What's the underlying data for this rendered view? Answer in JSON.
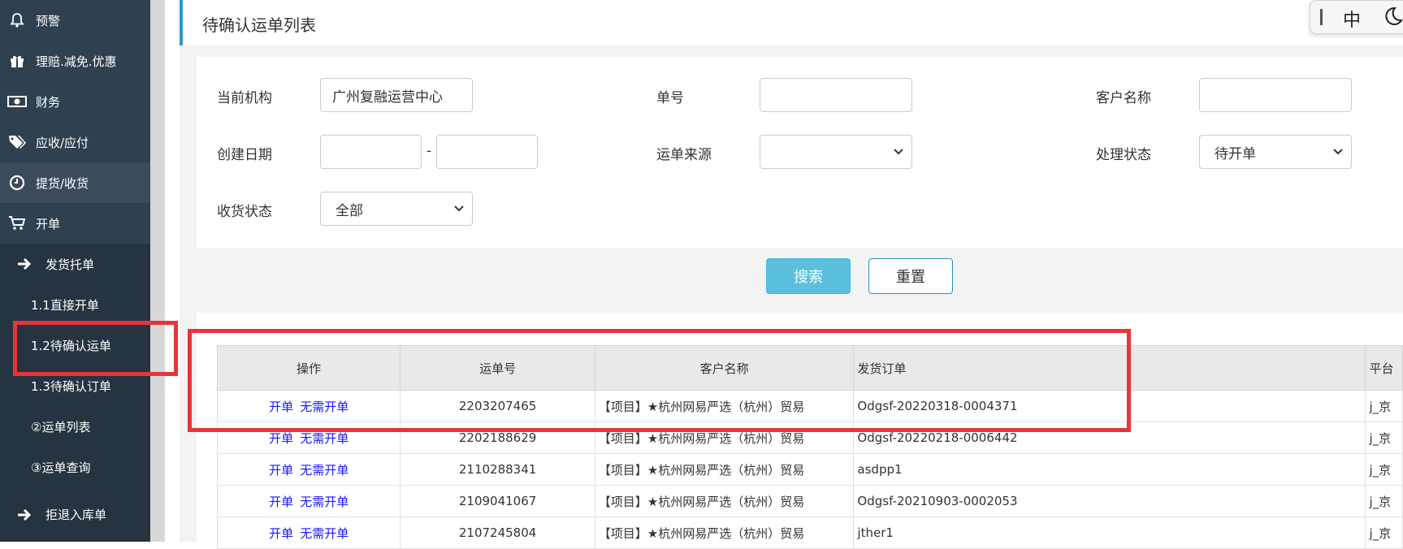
{
  "sidebar": {
    "items": [
      {
        "label": "预警",
        "icon": "bell-icon"
      },
      {
        "label": "理赔.减免.优惠",
        "icon": "gift-icon"
      },
      {
        "label": "财务",
        "icon": "money-icon"
      },
      {
        "label": "应收/应付",
        "icon": "tags-icon"
      },
      {
        "label": "提货/收货",
        "icon": "clock-icon"
      },
      {
        "label": "开单",
        "icon": "cart-icon"
      }
    ],
    "sub_items": [
      {
        "label": "发货托单",
        "icon": "arrow-right-icon"
      },
      {
        "label": "1.1直接开单"
      },
      {
        "label": "1.2待确认运单"
      },
      {
        "label": "1.3待确认订单"
      },
      {
        "label": "②运单列表"
      },
      {
        "label": "③运单查询"
      },
      {
        "label": "拒退入库单",
        "icon": "arrow-right-icon"
      }
    ]
  },
  "page": {
    "title": "待确认运单列表"
  },
  "ime": {
    "mode": "中"
  },
  "filters": {
    "org_label": "当前机构",
    "org_value": "广州复融运营中心",
    "order_no_label": "单号",
    "order_no_value": "",
    "customer_label": "客户名称",
    "customer_value": "",
    "create_date_label": "创建日期",
    "date_sep": "-",
    "source_label": "运单来源",
    "source_value": "",
    "status_label": "处理状态",
    "status_value": "待开单",
    "receive_label": "收货状态",
    "receive_value": "全部"
  },
  "buttons": {
    "search": "搜索",
    "reset": "重置"
  },
  "table": {
    "headers": [
      "操作",
      "运单号",
      "客户名称",
      "发货订单",
      "平台"
    ],
    "actions": [
      "开单",
      "无需开单"
    ],
    "rows": [
      {
        "no": "2203207465",
        "customer": "【项目】★杭州网易严选（杭州）贸易",
        "order": "Odgsf-20220318-0004371",
        "platform": "j_京"
      },
      {
        "no": "2202188629",
        "customer": "【项目】★杭州网易严选（杭州）贸易",
        "order": "Odgsf-20220218-0006442",
        "platform": "j_京"
      },
      {
        "no": "2110288341",
        "customer": "【项目】★杭州网易严选（杭州）贸易",
        "order": "asdpp1",
        "platform": "j_京"
      },
      {
        "no": "2109041067",
        "customer": "【项目】★杭州网易严选（杭州）贸易",
        "order": "Odgsf-20210903-0002053",
        "platform": "j_京"
      },
      {
        "no": "2107245804",
        "customer": "【项目】★杭州网易严选（杭州）贸易",
        "order": "jther1",
        "platform": "j_京"
      }
    ]
  },
  "colors": {
    "sidebar_bg": "#2f4050",
    "accent": "#2c99d4",
    "highlight": "#e8343a",
    "search_btn": "#5bc0de",
    "link": "#1a1aff"
  }
}
